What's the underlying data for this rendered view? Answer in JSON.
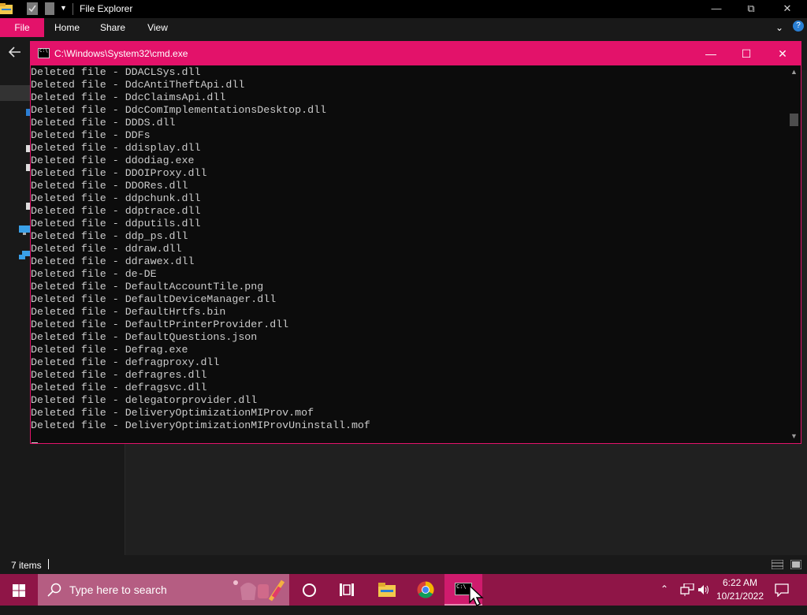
{
  "explorer": {
    "title": "File Explorer",
    "ribbon_tabs": [
      "File",
      "Home",
      "Share",
      "View"
    ],
    "status": {
      "item_count": "7 items"
    }
  },
  "cmd": {
    "title": "C:\\Windows\\System32\\cmd.exe",
    "lines": [
      "Deleted file - DDACLSys.dll",
      "Deleted file - DdcAntiTheftApi.dll",
      "Deleted file - DdcClaimsApi.dll",
      "Deleted file - DdcComImplementationsDesktop.dll",
      "Deleted file - DDDS.dll",
      "Deleted file - DDFs",
      "Deleted file - ddisplay.dll",
      "Deleted file - ddodiag.exe",
      "Deleted file - DDOIProxy.dll",
      "Deleted file - DDORes.dll",
      "Deleted file - ddpchunk.dll",
      "Deleted file - ddptrace.dll",
      "Deleted file - ddputils.dll",
      "Deleted file - ddp_ps.dll",
      "Deleted file - ddraw.dll",
      "Deleted file - ddrawex.dll",
      "Deleted file - de-DE",
      "Deleted file - DefaultAccountTile.png",
      "Deleted file - DefaultDeviceManager.dll",
      "Deleted file - DefaultHrtfs.bin",
      "Deleted file - DefaultPrinterProvider.dll",
      "Deleted file - DefaultQuestions.json",
      "Deleted file - Defrag.exe",
      "Deleted file - defragproxy.dll",
      "Deleted file - defragres.dll",
      "Deleted file - defragsvc.dll",
      "Deleted file - delegatorprovider.dll",
      "Deleted file - DeliveryOptimizationMIProv.mof",
      "Deleted file - DeliveryOptimizationMIProvUninstall.mof"
    ]
  },
  "taskbar": {
    "search_placeholder": "Type here to search",
    "time": "6:22 AM",
    "date": "10/21/2022"
  },
  "colors": {
    "accent": "#e3126a",
    "taskbar": "#8f1547",
    "console_bg": "#0c0c0c",
    "console_text": "#cccccc"
  },
  "icons": [
    "folder-icon",
    "properties-icon",
    "new-folder-icon",
    "back-arrow-icon",
    "windows-logo-icon",
    "search-icon",
    "cortana-icon",
    "task-view-icon",
    "file-explorer-icon",
    "chrome-icon",
    "cmd-icon",
    "chevron-up-icon",
    "network-icon",
    "volume-icon",
    "notification-icon"
  ]
}
